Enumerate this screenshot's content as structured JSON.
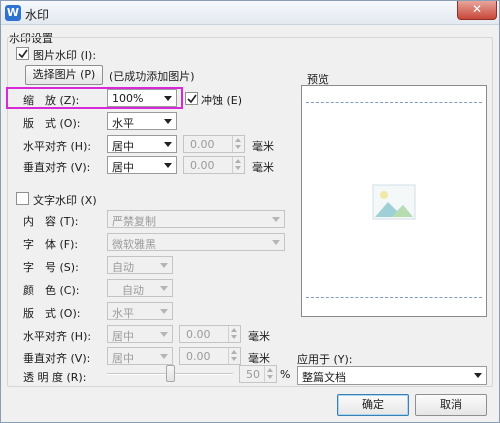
{
  "window": {
    "title": "水印",
    "app_icon_letter": "W",
    "close_glyph": "✕"
  },
  "group_title": "水印设置",
  "picture": {
    "checkbox_label": "图片水印",
    "checkbox_hotkey": "(I):",
    "checked": true,
    "select_button": "选择图片 (P)",
    "status": "(已成功添加图片)",
    "scale_label": "缩　放",
    "scale_hotkey": "(Z):",
    "scale_value": "100%",
    "washout_label": "冲蚀",
    "washout_hotkey": "(E)",
    "washout_checked": true,
    "layout_label": "版　式",
    "layout_hotkey": "(O):",
    "layout_value": "水平",
    "halign_label": "水平对齐",
    "halign_hotkey": "(H):",
    "halign_value": "居中",
    "halign_offset": "0.00",
    "valign_label": "垂直对齐",
    "valign_hotkey": "(V):",
    "valign_value": "居中",
    "valign_offset": "0.00",
    "unit": "毫米"
  },
  "text": {
    "checkbox_label": "文字水印",
    "checkbox_hotkey": "(X)",
    "checked": false,
    "content_label": "内　容",
    "content_hotkey": "(T):",
    "content_value": "严禁复制",
    "font_label": "字　体",
    "font_hotkey": "(F):",
    "font_value": "微软雅黑",
    "size_label": "字　号",
    "size_hotkey": "(S):",
    "size_value": "自动",
    "color_label": "颜　色",
    "color_hotkey": "(C):",
    "color_value": "自动",
    "layout_label": "版　式",
    "layout_hotkey": "(O):",
    "layout_value": "水平",
    "halign_label": "水平对齐",
    "halign_hotkey": "(H):",
    "halign_value": "居中",
    "halign_offset": "0.00",
    "valign_label": "垂直对齐",
    "valign_hotkey": "(V):",
    "valign_value": "居中",
    "valign_offset": "0.00",
    "unit": "毫米",
    "transparency_label": "透 明 度",
    "transparency_hotkey": "(R):",
    "transparency_value": "50",
    "transparency_unit": "%"
  },
  "preview": {
    "label": "预览",
    "image_icon": "picture-icon"
  },
  "apply": {
    "label": "应用于",
    "hotkey": "(Y):",
    "value": "整篇文档"
  },
  "buttons": {
    "ok": "确定",
    "cancel": "取消"
  },
  "colors": {
    "highlight": "#d829d8",
    "accent": "#2e72d2"
  }
}
